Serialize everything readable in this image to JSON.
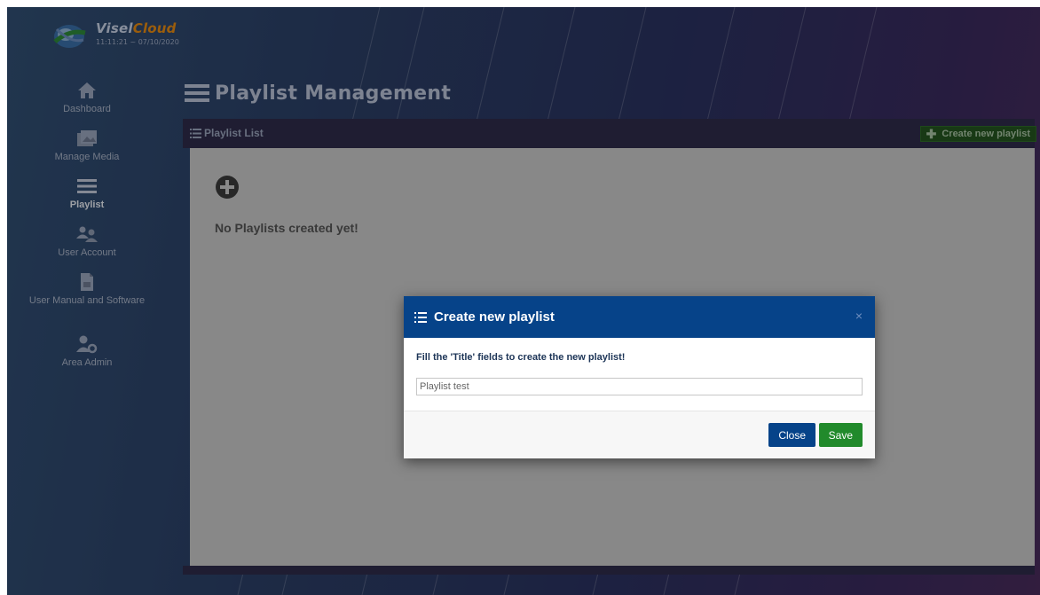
{
  "brand": {
    "name_part1": "Visel",
    "name_part2": "Cloud",
    "clock": "11:11:21 ~ 07/10/2020"
  },
  "sidebar": {
    "items": [
      {
        "label": "Dashboard"
      },
      {
        "label": "Manage Media"
      },
      {
        "label": "Playlist"
      },
      {
        "label": "User Account"
      },
      {
        "label": "User Manual and Software"
      },
      {
        "label": "Area Admin"
      }
    ]
  },
  "page": {
    "title": "Playlist Management"
  },
  "panel": {
    "title": "Playlist List",
    "create_button": "Create new playlist",
    "empty_message": "No Playlists created yet!"
  },
  "modal": {
    "title": "Create new playlist",
    "close_x": "×",
    "message": "Fill the 'Title' fields to create the new playlist!",
    "input_value": "Playlist test",
    "close_button": "Close",
    "save_button": "Save"
  },
  "colors": {
    "modal_header": "#064389",
    "save_button": "#218a2b",
    "brand_accent": "#e58a13"
  },
  "icons": {
    "dashboard": "home-icon",
    "media": "images-icon",
    "playlist": "bars-icon",
    "user_account": "users-icon",
    "manual": "file-icon",
    "area_admin": "user-gear-icon"
  }
}
